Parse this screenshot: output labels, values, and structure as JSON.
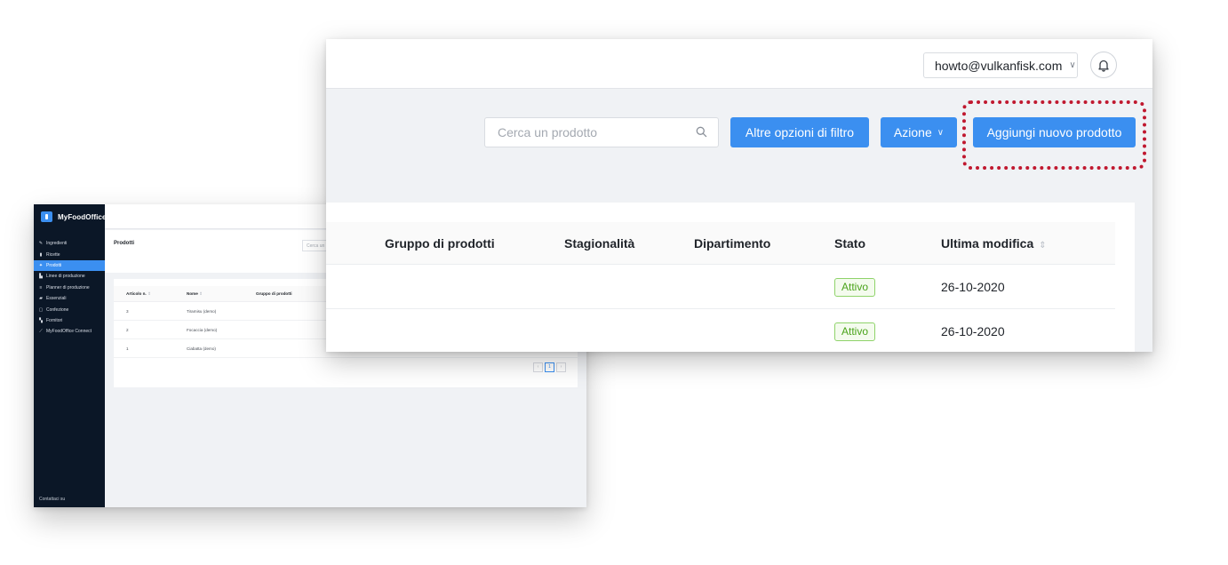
{
  "background_window": {
    "app_name": "MyFoodOffice",
    "sidebar": {
      "items": [
        {
          "label": "Ingredienti",
          "icon": "pencil-icon",
          "glyph": "✎",
          "active": false
        },
        {
          "label": "Ricette",
          "icon": "book-icon",
          "glyph": "▮",
          "active": false
        },
        {
          "label": "Prodotti",
          "icon": "product-icon",
          "glyph": "✦",
          "active": true
        },
        {
          "label": "Linee di produzione",
          "icon": "chart-icon",
          "glyph": "▙",
          "active": false
        },
        {
          "label": "Planner di produzione",
          "icon": "list-icon",
          "glyph": "≡",
          "active": false
        },
        {
          "label": "Essenziali",
          "icon": "bookmark-icon",
          "glyph": "▰",
          "active": false
        },
        {
          "label": "Confezione",
          "icon": "box-icon",
          "glyph": "▢",
          "active": false
        },
        {
          "label": "Fornitori",
          "icon": "truck-icon",
          "glyph": "▚",
          "active": false
        },
        {
          "label": "MyFoodOffice Connect",
          "icon": "link-icon",
          "glyph": "⟋",
          "active": false
        }
      ],
      "contact": "Contattaci su"
    },
    "page_title": "Prodotti",
    "search_placeholder": "Cerca un",
    "table": {
      "columns": [
        "Articolo n.",
        "Nome",
        "Gruppo di prodotti"
      ],
      "rows": [
        {
          "number": "3",
          "name": "Tiramisu (demo)"
        },
        {
          "number": "2",
          "name": "Focaccia (demo)"
        },
        {
          "number": "1",
          "name": "Ciabatta (demo)"
        }
      ]
    },
    "pagination": {
      "prev": "‹",
      "current": "1",
      "next": "›"
    }
  },
  "foreground_window": {
    "user_email": "howto@vulkanfisk.com",
    "search_placeholder": "Cerca un prodotto",
    "buttons": {
      "filter": "Altre opzioni di filtro",
      "action": "Azione",
      "add": "Aggiungi nuovo prodotto"
    },
    "table": {
      "columns": [
        "Gruppo di prodotti",
        "Stagionalità",
        "Dipartimento",
        "Stato",
        "Ultima modifica"
      ],
      "rows": [
        {
          "status": "Attivo",
          "modified": "26-10-2020"
        },
        {
          "status": "Attivo",
          "modified": "26-10-2020"
        }
      ]
    }
  },
  "colors": {
    "accent": "#3b8ff0",
    "sidebar_bg": "#0b1727",
    "highlight": "#c0182f",
    "status_active": "#4aa31a"
  }
}
